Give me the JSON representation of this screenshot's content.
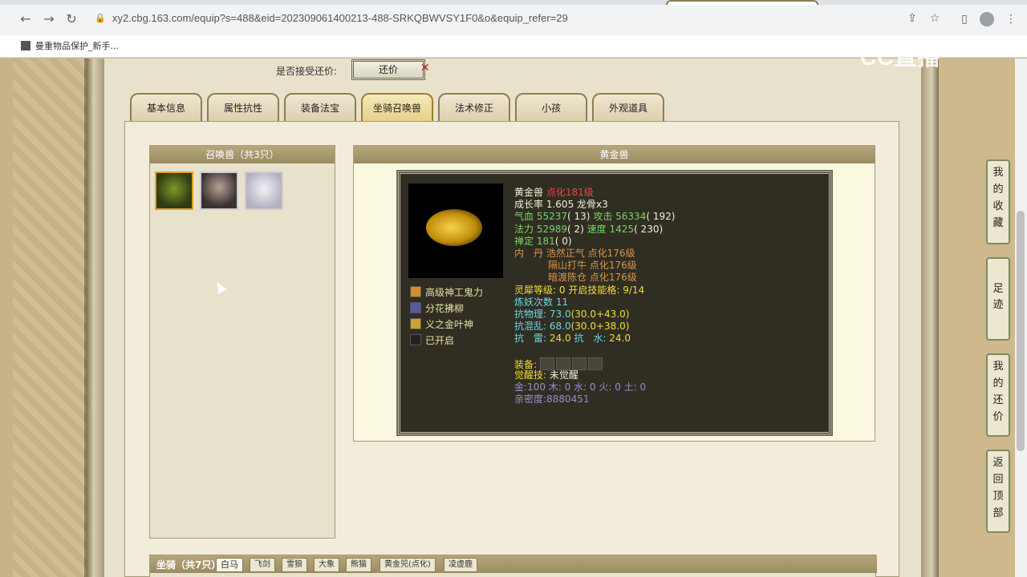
{
  "browser": {
    "url": "xy2.cbg.163.com/equip?s=488&eid=202309061400213-488-SRKQBWVSY1F0&o&equip_refer=29",
    "bookmark": "曼重物品保护_新手..."
  },
  "watermark": "CC直播",
  "offer": {
    "label": "是否接受还价:",
    "button": "还价",
    "cross": "✕"
  },
  "tabs": [
    "基本信息",
    "属性抗性",
    "装备法宝",
    "坐骑召唤兽",
    "法术修正",
    "小孩",
    "外观道具"
  ],
  "summon_list": {
    "title": "召唤兽（共3只）"
  },
  "detail": {
    "title": "黄金兽",
    "name": "黄金兽",
    "transform": "点化181级",
    "growth_label": "成长率",
    "growth": "1.605",
    "bone": "龙骨x3",
    "hp_label": "气血",
    "hp": "55237",
    "hp_add": "( 13)",
    "atk_label": "攻击",
    "atk": "56334",
    "atk_add": "( 192)",
    "mp_label": "法力",
    "mp": "52989",
    "mp_add": "( 2)",
    "spd_label": "速度",
    "spd": "1425",
    "spd_add": "( 230)",
    "def_label": "禅定",
    "def": "181",
    "def_add": "( 0)",
    "inner_label": "内　丹",
    "inner": [
      "浩然正气 点化176级",
      "隔山打牛 点化176级",
      "暗渡陈仓 点化176级"
    ],
    "spirit_label": "灵犀等级:",
    "spirit_level": "0",
    "slot_label": "开启技能格:",
    "slot_value": "9/14",
    "refine_label": "炼妖次数",
    "refine": "11",
    "phys_label": "抗物理:",
    "phys": "73.0",
    "phys_detail": "(30.0+43.0)",
    "chaos_label": "抗混乱:",
    "chaos": "68.0",
    "chaos_detail": "(30.0+38.0)",
    "thunder_label": "抗　雷:",
    "thunder": "24.0",
    "water_label": "抗　水:",
    "water": "24.0",
    "equip_label": "装备:",
    "awaken_label": "觉醒技:",
    "awaken": "未觉醒",
    "elements": "金:100 木: 0 水: 0 火: 0 土: 0",
    "intimacy": "亲密度:8880451",
    "skills": [
      "高级神工鬼力",
      "分花拂柳",
      "义之金叶神",
      "已开启"
    ]
  },
  "mounts": {
    "label": "坐骑（共7只）",
    "tabs": [
      "白马",
      "飞剑",
      "雪狼",
      "大象",
      "熊猫",
      "黄金兕(点化)",
      "凌虚鹿"
    ]
  },
  "side_buttons": [
    "我的收藏",
    "足迹",
    "我的还价",
    "返回顶部"
  ]
}
